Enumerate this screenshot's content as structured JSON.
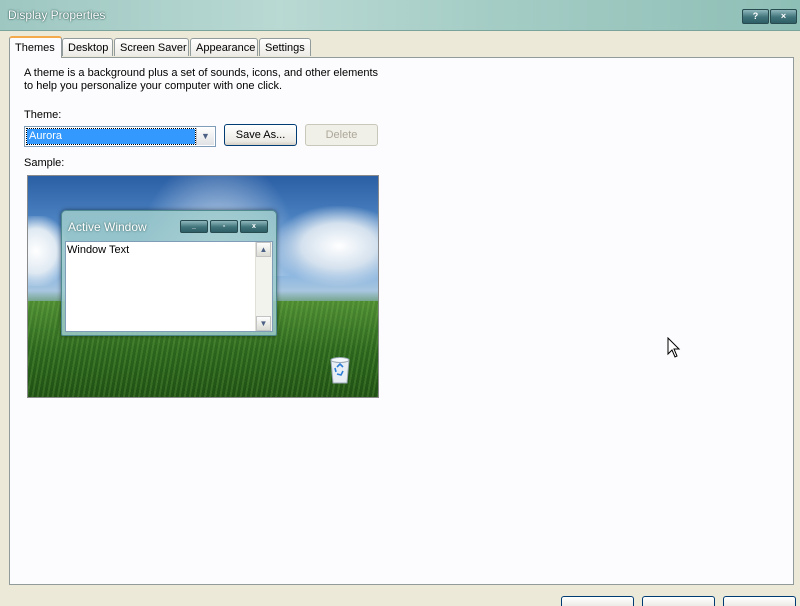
{
  "window": {
    "title": "Display Properties"
  },
  "titlebar_buttons": {
    "help": "?",
    "close": "×"
  },
  "tabs": [
    {
      "label": "Themes",
      "active": true
    },
    {
      "label": "Desktop",
      "active": false
    },
    {
      "label": "Screen Saver",
      "active": false
    },
    {
      "label": "Appearance",
      "active": false
    },
    {
      "label": "Settings",
      "active": false
    }
  ],
  "themes_page": {
    "description_line1": "A theme is a background plus a set of sounds, icons, and other elements",
    "description_line2": "to help you personalize your computer with one click.",
    "theme_label": "Theme:",
    "theme_value": "Aurora",
    "save_as_label": "Save As...",
    "delete_label": "Delete",
    "sample_label": "Sample:"
  },
  "sample": {
    "window_title": "Active Window",
    "window_text": "Window Text"
  },
  "colors": {
    "selection": "#3399ff",
    "active_tab_accent": "#f4a94a",
    "titlebar": "#a5cdc6"
  },
  "icons": [
    "help-icon",
    "close-icon",
    "dropdown-arrow-icon",
    "minimize-icon",
    "maximize-icon",
    "scroll-up-icon",
    "scroll-down-icon",
    "recycle-bin-icon",
    "mouse-cursor-icon"
  ]
}
